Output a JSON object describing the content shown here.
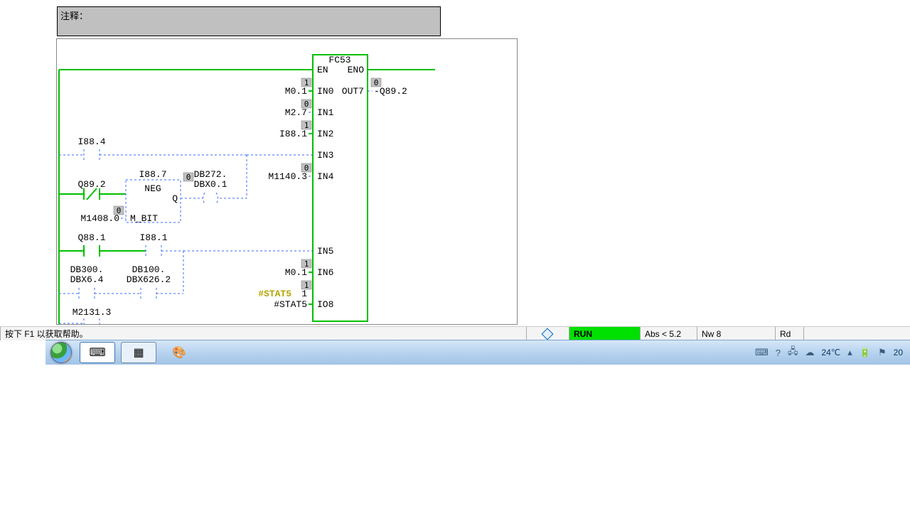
{
  "comment": {
    "label": "注释："
  },
  "block": {
    "name": "FC53",
    "en": "EN",
    "eno": "ENO",
    "inputs": [
      {
        "pin": "IN0",
        "addr": "M0.1",
        "state": "1"
      },
      {
        "pin": "IN1",
        "addr": "M2.7",
        "state": "0"
      },
      {
        "pin": "IN2",
        "addr": "I88.1",
        "state": "1"
      },
      {
        "pin": "IN3",
        "addr": ""
      },
      {
        "pin": "IN4",
        "addr": "M1140.3",
        "state": "0"
      },
      {
        "pin": "IN5",
        "addr": ""
      },
      {
        "pin": "IN6",
        "addr": "M0.1",
        "state": "1"
      },
      {
        "pin": "IO8",
        "addr": "#STAT5",
        "state": "1",
        "extra": "1"
      }
    ],
    "outputs": [
      {
        "pin": "OUT7",
        "addr": "Q89.2",
        "state": "0"
      }
    ],
    "stat_label": "#STAT5"
  },
  "contacts": {
    "i884": "I88.4",
    "q892": "Q89.2",
    "i887": "I88.7",
    "neg": "NEG",
    "q": "Q",
    "mbit": "M_BIT",
    "m1408": "M1408.0",
    "m1408_state": "0",
    "db272_a": "DB272.",
    "db272_b": "DBX0.1",
    "db272_state": "0",
    "q881": "Q88.1",
    "i881": "I88.1",
    "db300_a": "DB300.",
    "db300_b": "DBX6.4",
    "db100_a": "DB100.",
    "db100_b": "DBX626.2",
    "m2131": "M2131.3"
  },
  "status_bar": {
    "help": "按下 F1 以获取帮助。",
    "run": "RUN",
    "abs": "Abs < 5.2",
    "nw": "Nw 8",
    "rd": "Rd"
  },
  "tray": {
    "temp": "24℃",
    "time_suffix": "20"
  },
  "colors": {
    "on": "#00d000",
    "wire": "#00c000",
    "dot_wire": "#3a6aff"
  }
}
